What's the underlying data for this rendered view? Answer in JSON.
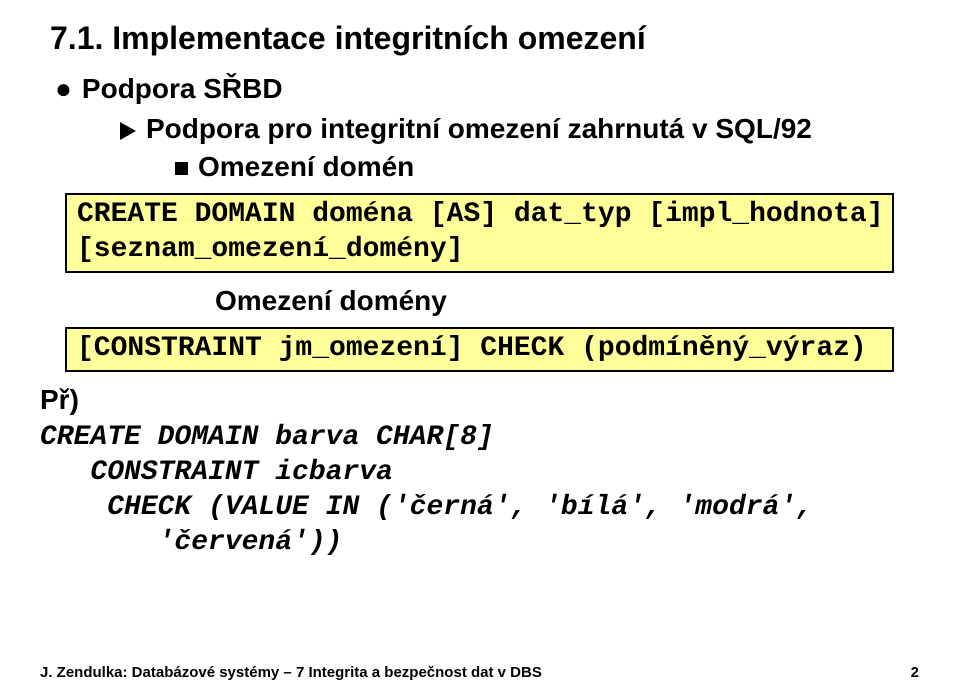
{
  "heading": "7.1.  Implementace integritních omezení",
  "bullet1": "Podpora SŘBD",
  "arrow1": "Podpora pro integritní omezení zahrnutá v SQL/92",
  "square1": "Omezení domén",
  "code1": "CREATE DOMAIN doména [AS] dat_typ [impl_hodnota]\n[seznam_omezení_domény]",
  "sublabel": "Omezení domény",
  "code2": "[CONSTRAINT jm_omezení] CHECK (podmíněný_výraz)",
  "example_label": "Př)",
  "example_code": "CREATE DOMAIN barva CHAR[8]\n   CONSTRAINT icbarva\n    CHECK (VALUE IN ('černá', 'bílá', 'modrá',\n       'červená'))",
  "footer_left": "J. Zendulka: Databázové systémy – 7 Integrita a bezpečnost dat v DBS",
  "footer_right": "2"
}
